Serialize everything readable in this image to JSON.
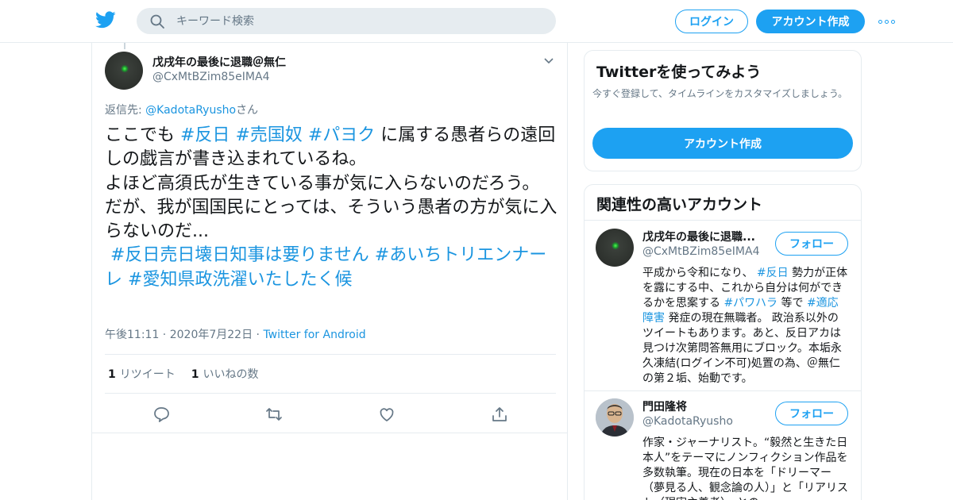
{
  "colors": {
    "accent": "#1da1f2",
    "link": "#1b95e0",
    "muted": "#657786",
    "border": "#e6ecf0"
  },
  "header": {
    "search_placeholder": "キーワード検索",
    "login_label": "ログイン",
    "signup_label": "アカウント作成",
    "logo_icon": "twitter-bird-icon",
    "more_icon": "more-dots-icon"
  },
  "tweet": {
    "author_name": "戊戌年の最後に退職＠無仁",
    "author_handle": "@CxMtBZim85eIMA4",
    "reply_prefix": "返信先: ",
    "reply_handle": "@KadotaRyusho",
    "reply_suffix": "さん",
    "text_part1": "ここでも ",
    "hashtag1": "#反日",
    "hashtag2": "#売国奴",
    "hashtag3": "#パヨク",
    "text_part2": " に属する愚者らの遠回しの戯言が書き込まれているね。",
    "text_part3": "よほど高須氏が生きている事が気に入らないのだろう。",
    "text_part4": "だが、我が国国民にとっては、そういう愚者の方が気に入らないのだ...",
    "hashtag4": "#反日売日壊日知事は要りません",
    "hashtag5": "#あいちトリエンナーレ",
    "hashtag6": "#愛知県政洗濯いたしたく候",
    "time": "午後11:11",
    "date": "2020年7月22日",
    "source": "Twitter for Android",
    "meta_sep": " · ",
    "retweet_count": "1",
    "retweet_label": "リツイート",
    "like_count": "1",
    "like_label": "いいねの数"
  },
  "sidebar": {
    "try_title": "Twitterを使ってみよう",
    "try_subtitle": "今すぐ登録して、タイムラインをカスタマイズしましょう。",
    "try_button": "アカウント作成",
    "related_title": "関連性の高いアカウント",
    "accounts": [
      {
        "name": "戊戌年の最後に退職...",
        "handle": "@CxMtBZim85eIMA4",
        "follow_label": "フォロー",
        "bio_1": "平成から令和になり、 ",
        "bio_ht1": "#反日",
        "bio_2": " 勢力が正体を露にする中、これから自分は何ができるかを思案する ",
        "bio_ht2": "#パワハラ",
        "bio_3": " 等で ",
        "bio_ht3": "#適応障害",
        "bio_4": " 発症の現在無職者。 政治系以外のツイートもあります。あと、反日アカは見つけ次第問答無用にブロック。本垢永久凍結(ログイン不可)処置の為、＠無仁の第２垢、始動です。"
      },
      {
        "name": "門田隆将",
        "handle": "@KadotaRyusho",
        "follow_label": "フォロー",
        "bio": "作家・ジャーナリスト。“毅然と生きた日本人”をテーマにノンフィクション作品を多数執筆。現在の日本を「ドリーマー（夢見る人、観念論の人）」と「リアリスト（現実主義者）」との"
      }
    ]
  }
}
